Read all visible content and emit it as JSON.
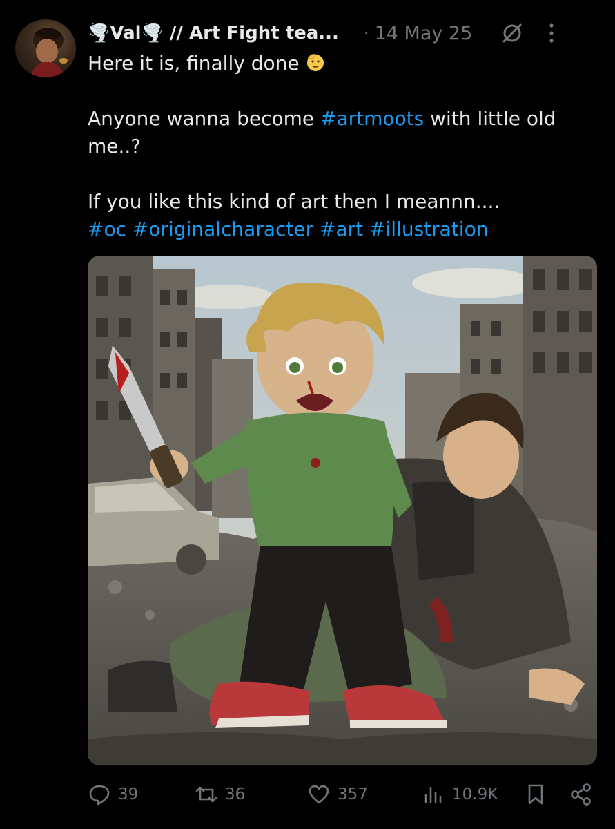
{
  "tweet": {
    "author": {
      "display_name": "🌪️Val🌪️ // Art Fight tea..."
    },
    "date": "14 May 25",
    "separator": "·",
    "text_line1": "Here it is, finally done",
    "text_line2": "Anyone wanna become ",
    "tag_artmoots": "#artmoots",
    "text_line2b": " with little old me..?",
    "text_line3": "If you like this kind of art then I meannn....",
    "tag_oc": "#oc",
    "tag_originalcharacter": "#originalcharacter",
    "tag_art": "#art",
    "tag_illustration": "#illustration",
    "emoji": "saluting-face"
  },
  "actions": {
    "replies": "39",
    "reposts": "36",
    "likes": "357",
    "views": "10.9K"
  },
  "colors": {
    "background": "#000000",
    "text": "#e7e9ea",
    "muted": "#71767b",
    "link": "#1d9bf0"
  }
}
